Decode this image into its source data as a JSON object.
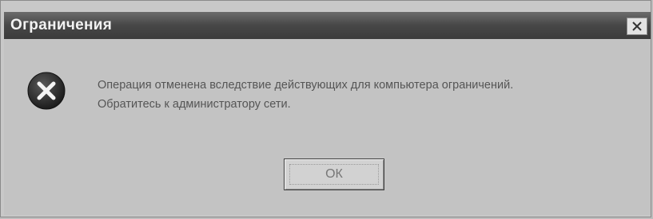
{
  "dialog": {
    "title": "Ограничения",
    "message_line1": "Операция отменена вследствие действующих для компьютера ограничений.",
    "message_line2": "Обратитесь к администратору сети.",
    "ok_label": "ОК",
    "icons": {
      "error": "error-x-icon",
      "close": "close-x-icon"
    },
    "colors": {
      "titlebar": "#474747",
      "title_text": "#f2f2f2",
      "dialog_bg": "#c3c3c3",
      "error_circle": "#2a2a2a"
    }
  }
}
